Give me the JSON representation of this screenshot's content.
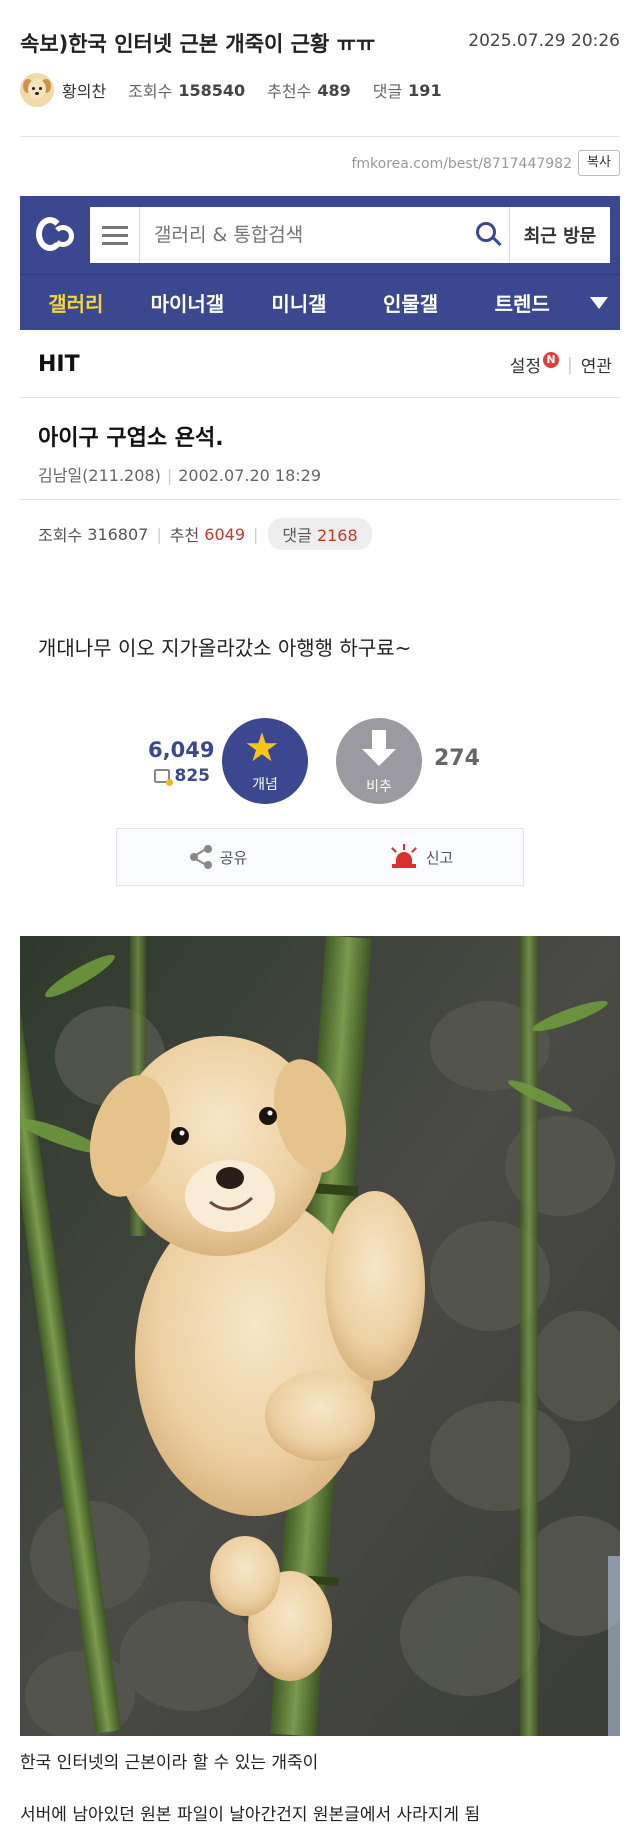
{
  "post": {
    "title": "속보)한국 인터넷 근본 개죽이 근황 ㅠㅠ",
    "date": "2025.07.29 20:26",
    "author": "황의찬",
    "views_label": "조회수",
    "views": "158540",
    "recommend_label": "추천수",
    "recommend": "489",
    "comments_label": "댓글",
    "comments": "191"
  },
  "source": {
    "url": "fmkorea.com/best/8717447982",
    "copy_label": "복사"
  },
  "dc": {
    "search_placeholder": "갤러리 & 통합검색",
    "recent_label": "최근 방문",
    "nav": [
      "갤러리",
      "마이너갤",
      "미니갤",
      "인물갤",
      "트렌드"
    ],
    "hit_label": "HIT",
    "settings_label": "설정",
    "n_badge": "N",
    "related_label": "연관",
    "post_title": "아이구 구엽소 욘석.",
    "post_author": "김남일(211.208)",
    "post_date": "2002.07.20 18:29",
    "views_label": "조회수",
    "views": "316807",
    "recommend_label": "추천",
    "recommend": "6049",
    "reply_label": "댓글",
    "reply": "2168",
    "body": "개대나무 이오 지가올라갔소 아행행 하구료~",
    "vote_up_count": "6,049",
    "vote_fix_count": "825",
    "vote_up_label": "개념",
    "vote_down_label": "비추",
    "vote_down_count": "274",
    "share_label": "공유",
    "report_label": "신고"
  },
  "captions": {
    "line1": "한국 인터넷의 근본이라 할 수 있는 개죽이",
    "line2": "서버에 남아있던 원본 파일이 날아간건지 원본글에서 사라지게 됨"
  },
  "colors": {
    "dc_blue": "#3b4890",
    "dc_active_nav": "#f5d63b",
    "red_value": "#c0392b"
  },
  "icons": [
    "dc-logo-icon",
    "hamburger-icon",
    "search-icon",
    "chevron-down-icon",
    "star-icon",
    "arrow-down-icon",
    "share-icon",
    "siren-icon"
  ]
}
